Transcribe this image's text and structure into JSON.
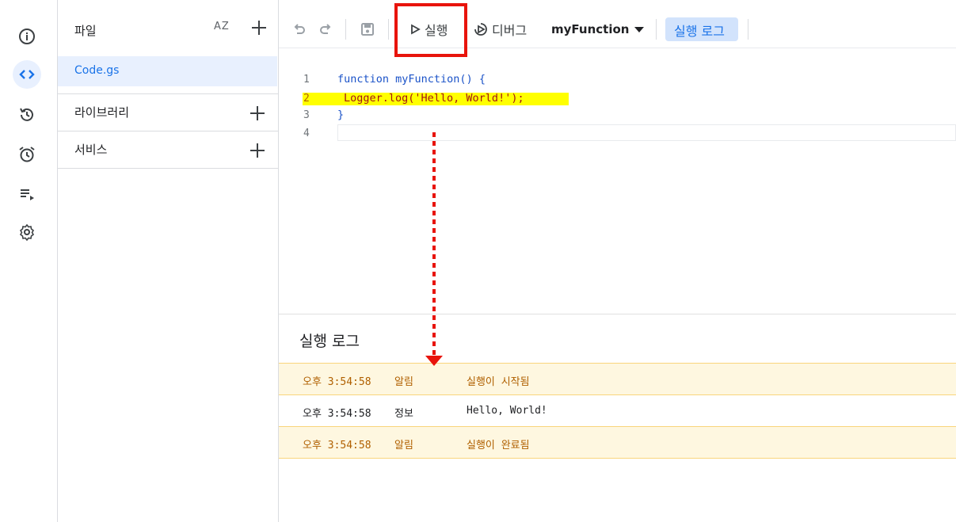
{
  "sidebar": {
    "icons": [
      "info-icon",
      "code-icon",
      "history-icon",
      "alarm-icon",
      "executions-icon",
      "settings-icon"
    ]
  },
  "files_panel": {
    "title": "파일",
    "sort_label": "AZ",
    "files": [
      {
        "name": "Code.gs"
      }
    ],
    "libraries_label": "라이브러리",
    "services_label": "서비스"
  },
  "toolbar": {
    "run_label": "실행",
    "debug_label": "디버그",
    "function_select": "myFunction",
    "log_button_label": "실행 로그"
  },
  "editor": {
    "line_numbers": [
      "1",
      "2",
      "3",
      "4"
    ],
    "lines": [
      {
        "kw": "function",
        "rest": " myFunction() {"
      },
      {
        "code": "Logger.log('Hello, World!');"
      },
      {
        "code": "}"
      },
      {
        "code": ""
      }
    ]
  },
  "log_panel": {
    "title": "실행 로그",
    "rows": [
      {
        "time": "오후 3:54:58",
        "level": "알림",
        "message": "실행이 시작됨"
      },
      {
        "time": "오후 3:54:58",
        "level": "정보",
        "message": "Hello, World!"
      },
      {
        "time": "오후 3:54:58",
        "level": "알림",
        "message": "실행이 완료됨"
      }
    ]
  },
  "colors": {
    "accent": "#1a73e8",
    "highlight": "#ffff00",
    "annotation_red": "#e8140c",
    "warn_bg": "#fef7e0",
    "warn_text": "#b06000"
  }
}
